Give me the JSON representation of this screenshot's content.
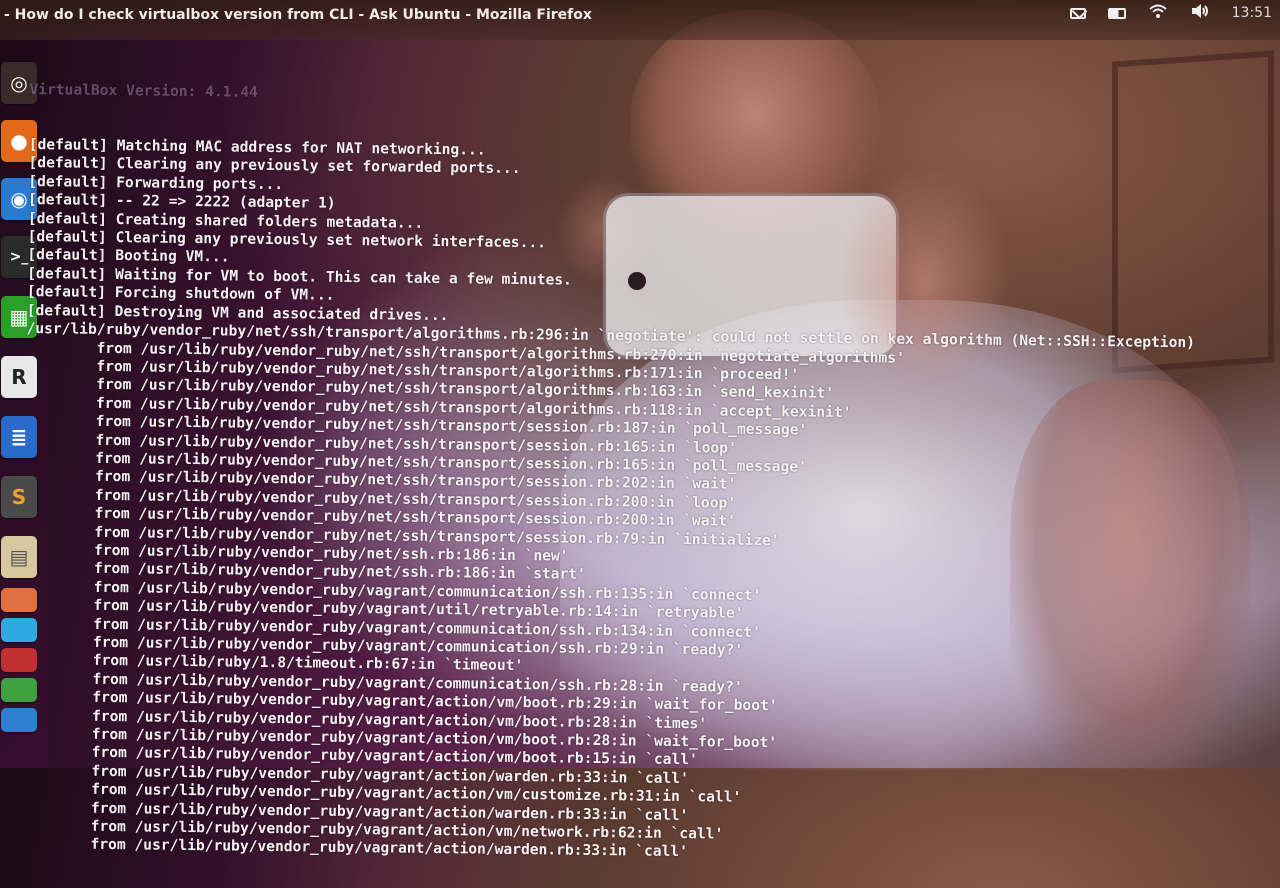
{
  "window": {
    "title": "- How do I check virtualbox version from CLI - Ask Ubuntu - Mozilla Firefox"
  },
  "panel": {
    "clock": "13:51",
    "indicators": [
      "mail-icon",
      "battery-icon",
      "wifi-icon",
      "volume-icon"
    ]
  },
  "launcher": {
    "items": [
      {
        "name": "ubuntu-dash",
        "glyph": "◎",
        "color": "#3a2a2a"
      },
      {
        "name": "firefox",
        "glyph": "●",
        "color": "#e06a1a"
      },
      {
        "name": "chromium",
        "glyph": "◉",
        "color": "#2a7ad0"
      },
      {
        "name": "terminal",
        "glyph": ">_",
        "color": "#2a2a2a"
      },
      {
        "name": "libreoffice-calc",
        "glyph": "▦",
        "color": "#2aa02a"
      },
      {
        "name": "rstudio",
        "glyph": "R",
        "color": "#e8e8e8"
      },
      {
        "name": "libreoffice-writer",
        "glyph": "≣",
        "color": "#2a6ac8"
      },
      {
        "name": "sublime-text",
        "glyph": "S",
        "color": "#4a4a4a"
      },
      {
        "name": "document-viewer",
        "glyph": "▤",
        "color": "#d8c8a0"
      },
      {
        "name": "app-stack-1",
        "glyph": "",
        "color": "#e07040"
      },
      {
        "name": "app-stack-2",
        "glyph": "",
        "color": "#30a8e0"
      },
      {
        "name": "app-stack-3",
        "glyph": "",
        "color": "#c03030"
      },
      {
        "name": "app-stack-4",
        "glyph": "",
        "color": "#40a040"
      },
      {
        "name": "app-stack-5",
        "glyph": "",
        "color": "#3080d0"
      }
    ]
  },
  "terminal": {
    "version_line": "VirtualBox Version: 4.1.44",
    "lines": [
      "[default] Matching MAC address for NAT networking...",
      "[default] Clearing any previously set forwarded ports...",
      "[default] Forwarding ports...",
      "[default] -- 22 => 2222 (adapter 1)",
      "[default] Creating shared folders metadata...",
      "[default] Clearing any previously set network interfaces...",
      "[default] Booting VM...",
      "[default] Waiting for VM to boot. This can take a few minutes.",
      "[default] Forcing shutdown of VM...",
      "[default] Destroying VM and associated drives...",
      "/usr/lib/ruby/vendor_ruby/net/ssh/transport/algorithms.rb:296:in `negotiate': could not settle on kex algorithm (Net::SSH::Exception)",
      "        from /usr/lib/ruby/vendor_ruby/net/ssh/transport/algorithms.rb:270:in `negotiate_algorithms'",
      "        from /usr/lib/ruby/vendor_ruby/net/ssh/transport/algorithms.rb:171:in `proceed!'",
      "        from /usr/lib/ruby/vendor_ruby/net/ssh/transport/algorithms.rb:163:in `send_kexinit'",
      "        from /usr/lib/ruby/vendor_ruby/net/ssh/transport/algorithms.rb:118:in `accept_kexinit'",
      "        from /usr/lib/ruby/vendor_ruby/net/ssh/transport/session.rb:187:in `poll_message'",
      "        from /usr/lib/ruby/vendor_ruby/net/ssh/transport/session.rb:165:in `loop'",
      "        from /usr/lib/ruby/vendor_ruby/net/ssh/transport/session.rb:165:in `poll_message'",
      "        from /usr/lib/ruby/vendor_ruby/net/ssh/transport/session.rb:202:in `wait'",
      "        from /usr/lib/ruby/vendor_ruby/net/ssh/transport/session.rb:200:in `loop'",
      "        from /usr/lib/ruby/vendor_ruby/net/ssh/transport/session.rb:200:in `wait'",
      "        from /usr/lib/ruby/vendor_ruby/net/ssh/transport/session.rb:79:in `initialize'",
      "        from /usr/lib/ruby/vendor_ruby/net/ssh.rb:186:in `new'",
      "        from /usr/lib/ruby/vendor_ruby/net/ssh.rb:186:in `start'",
      "        from /usr/lib/ruby/vendor_ruby/vagrant/communication/ssh.rb:135:in `connect'",
      "        from /usr/lib/ruby/vendor_ruby/vagrant/util/retryable.rb:14:in `retryable'",
      "        from /usr/lib/ruby/vendor_ruby/vagrant/communication/ssh.rb:134:in `connect'",
      "        from /usr/lib/ruby/vendor_ruby/vagrant/communication/ssh.rb:29:in `ready?'",
      "        from /usr/lib/ruby/1.8/timeout.rb:67:in `timeout'",
      "        from /usr/lib/ruby/vendor_ruby/vagrant/communication/ssh.rb:28:in `ready?'",
      "        from /usr/lib/ruby/vendor_ruby/vagrant/action/vm/boot.rb:29:in `wait_for_boot'",
      "        from /usr/lib/ruby/vendor_ruby/vagrant/action/vm/boot.rb:28:in `times'",
      "        from /usr/lib/ruby/vendor_ruby/vagrant/action/vm/boot.rb:28:in `wait_for_boot'",
      "        from /usr/lib/ruby/vendor_ruby/vagrant/action/vm/boot.rb:15:in `call'",
      "        from /usr/lib/ruby/vendor_ruby/vagrant/action/warden.rb:33:in `call'",
      "        from /usr/lib/ruby/vendor_ruby/vagrant/action/vm/customize.rb:31:in `call'",
      "        from /usr/lib/ruby/vendor_ruby/vagrant/action/warden.rb:33:in `call'",
      "        from /usr/lib/ruby/vendor_ruby/vagrant/action/vm/network.rb:62:in `call'",
      "        from /usr/lib/ruby/vendor_ruby/vagrant/action/warden.rb:33:in `call'"
    ]
  }
}
